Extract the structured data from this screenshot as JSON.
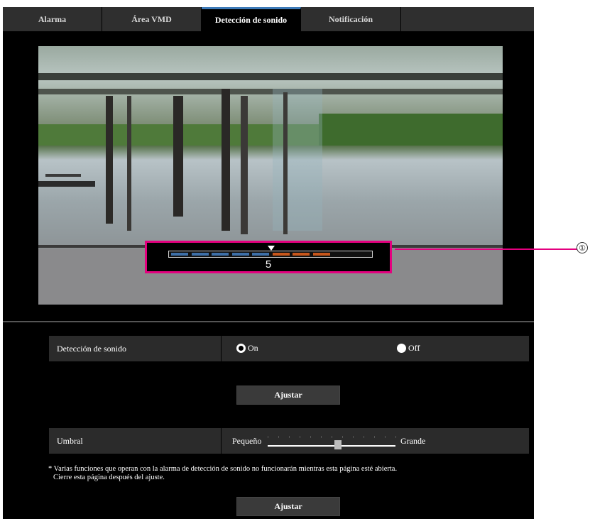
{
  "tabs": [
    {
      "label": "Alarma",
      "active": false
    },
    {
      "label": "Área VMD",
      "active": false
    },
    {
      "label": "Detección de sonido",
      "active": true
    },
    {
      "label": "Notificación",
      "active": false
    }
  ],
  "meter": {
    "value": "5",
    "fill_fraction": 0.5,
    "segments": [
      "blue",
      "blue",
      "blue",
      "blue",
      "blue",
      "orange",
      "orange",
      "orange",
      "empty",
      "empty"
    ],
    "colors": {
      "blue": "#3d6fa8",
      "orange": "#c8561b",
      "empty": "#111111",
      "highlight": "#e4007f"
    }
  },
  "callout": {
    "number": "①"
  },
  "detection": {
    "label": "Detección de sonido",
    "options": [
      {
        "label": "On",
        "selected": true
      },
      {
        "label": "Off",
        "selected": false
      }
    ]
  },
  "buttons": {
    "apply1": "Ajustar",
    "apply2": "Ajustar"
  },
  "threshold": {
    "label": "Umbral",
    "min_label": "Pequeño",
    "max_label": "Grande",
    "level_fraction": 0.55
  },
  "note": {
    "line1": "* Varias funciones que operan con la alarma de detección de sonido no funcionarán mientras esta página esté abierta.",
    "line2": "Cierre esta página después del ajuste."
  }
}
